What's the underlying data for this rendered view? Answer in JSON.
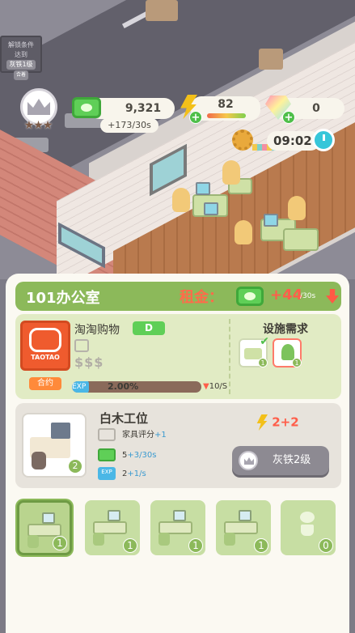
{
  "scene": {
    "unlock_sign": {
      "title": "解锁条件",
      "label": "达到",
      "level": "灰铁1级",
      "foot": "合着"
    }
  },
  "hud": {
    "rank_stars": "★★★",
    "money": "9,321",
    "money_rate": "+173/30s",
    "energy": "82",
    "energy_level_fraction": 0.8,
    "gems": "0",
    "clock": "09:02"
  },
  "panel": {
    "room_name": "101办公室",
    "rent_label": "租金：",
    "rent_value": "+44",
    "rent_unit": "/30s",
    "company": {
      "logo_text": "TAOTAO",
      "name": "淘淘购物",
      "grade": "D",
      "price_level": "$$$",
      "contract_tag": "合约",
      "exp_badge": "EXP",
      "exp_percent_text": "2.00%",
      "exp_fraction": 0.02,
      "exp_rate": "10/S"
    },
    "facility": {
      "title": "设施需求",
      "items": [
        {
          "icon": "desk-icon",
          "count": "1",
          "met": true
        },
        {
          "icon": "plant-icon",
          "count": "1",
          "met": false
        }
      ]
    },
    "item": {
      "name": "白木工位",
      "count": "2",
      "furniture_score_label": "家具评分",
      "furniture_score_bonus": "+1",
      "money_base": "5",
      "money_bonus": "+3/30s",
      "exp_badge": "EXP",
      "exp_base": "2",
      "exp_bonus": "+1/s",
      "energy_bonus": "2+2",
      "unlock_button": "灰铁2级"
    },
    "tray": [
      {
        "type": "desk",
        "count": "1",
        "selected": true
      },
      {
        "type": "desk",
        "count": "1",
        "selected": false
      },
      {
        "type": "desk",
        "count": "1",
        "selected": false
      },
      {
        "type": "desk",
        "count": "1",
        "selected": false
      },
      {
        "type": "plant",
        "count": "0",
        "selected": false
      }
    ]
  },
  "colors": {
    "panel_green": "#8cb95a",
    "rent_red": "#ff5e4a",
    "money_green": "#5fcf57",
    "exp_blue": "#4ab7e6"
  }
}
